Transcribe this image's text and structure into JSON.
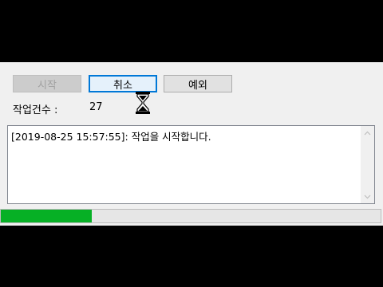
{
  "toolbar": {
    "start_label": "시작",
    "cancel_label": "취소",
    "exception_label": "예외"
  },
  "status": {
    "count_label": "작업건수 :",
    "count_value": "27"
  },
  "log": {
    "text": "[2019-08-25 15:57:55]: 작업을 시작합니다."
  },
  "progress": {
    "percent": 24,
    "color": "#06b025"
  },
  "icons": {
    "cursor": "hourglass-icon",
    "scroll_up": "chevron-up-icon",
    "scroll_down": "chevron-down-icon"
  }
}
